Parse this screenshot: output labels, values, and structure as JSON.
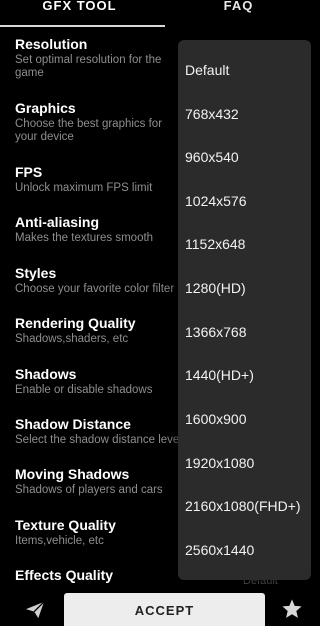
{
  "tabs": [
    {
      "label": "GFX TOOL",
      "active": true
    },
    {
      "label": "FAQ",
      "active": false
    }
  ],
  "settings": [
    {
      "title": "Resolution",
      "desc": "Set optimal resolution for the game"
    },
    {
      "title": "Graphics",
      "desc": "Choose the best graphics for your device"
    },
    {
      "title": "FPS",
      "desc": "Unlock maximum FPS limit"
    },
    {
      "title": "Anti-aliasing",
      "desc": "Makes the textures smooth"
    },
    {
      "title": "Styles",
      "desc": "Choose your favorite color filter"
    },
    {
      "title": "Rendering Quality",
      "desc": "Shadows,shaders, etc"
    },
    {
      "title": "Shadows",
      "desc": "Enable or disable shadows"
    },
    {
      "title": "Shadow Distance",
      "desc": "Select the shadow distance level"
    },
    {
      "title": "Moving Shadows",
      "desc": "Shadows of players and cars"
    },
    {
      "title": "Texture Quality",
      "desc": "Items,vehicle, etc"
    },
    {
      "title": "Effects Quality",
      "desc": ""
    }
  ],
  "resolution_dropdown": {
    "options": [
      "Default",
      "768x432",
      "960x540",
      "1024x576",
      "1152x648",
      "1280(HD)",
      "1366x768",
      "1440(HD+)",
      "1600x900",
      "1920x1080",
      "2160x1080(FHD+)",
      "2560x1440"
    ]
  },
  "partial_behind_text": "Default",
  "accept_label": "ACCEPT",
  "icons": {
    "left": "send-icon",
    "right": "star-icon"
  }
}
